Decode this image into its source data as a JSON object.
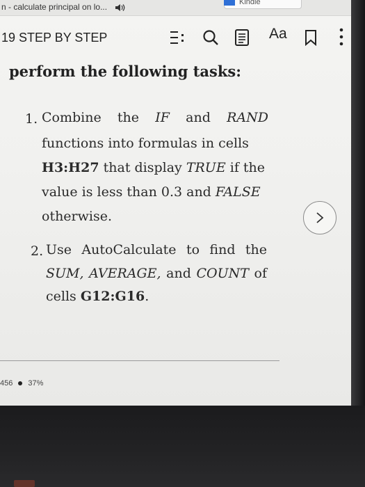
{
  "browser": {
    "tab_title": "n - calculate principal on lo...",
    "kindle_tab_label": "Kindle"
  },
  "toolbar": {
    "book_title": "19 STEP BY STEP",
    "font_settings_label": "Aa",
    "icons": [
      "table-of-contents-icon",
      "search-icon",
      "notes-icon",
      "font-settings-icon",
      "bookmark-icon",
      "more-options-icon"
    ]
  },
  "page": {
    "heading": "perform the following tasks:",
    "task1": {
      "number": "1.",
      "w1": "Combine",
      "w2": "the",
      "w3": "IF",
      "w4": "and",
      "w5": "RAND",
      "line2": "functions into formulas in cells",
      "range": "H3:H27",
      "mid3a": " that display ",
      "true_word": "TRUE",
      "end3": " if the",
      "line4a": "value is less than 0.3 and ",
      "false_word": "FALSE",
      "line5": "otherwise."
    },
    "task2": {
      "number": "2.",
      "w1": "Use",
      "w2": "AutoCalculate",
      "w3": "to",
      "w4": "find",
      "w5": "the",
      "fn_sum": "SUM,",
      "fn_avg": "AVERAGE,",
      "and_word": "and",
      "fn_count": "COUNT",
      "of_word": "of",
      "line3a": "cells ",
      "range": "G12:G16",
      "line3b": "."
    }
  },
  "footer": {
    "location": "456",
    "percent": "37%"
  }
}
